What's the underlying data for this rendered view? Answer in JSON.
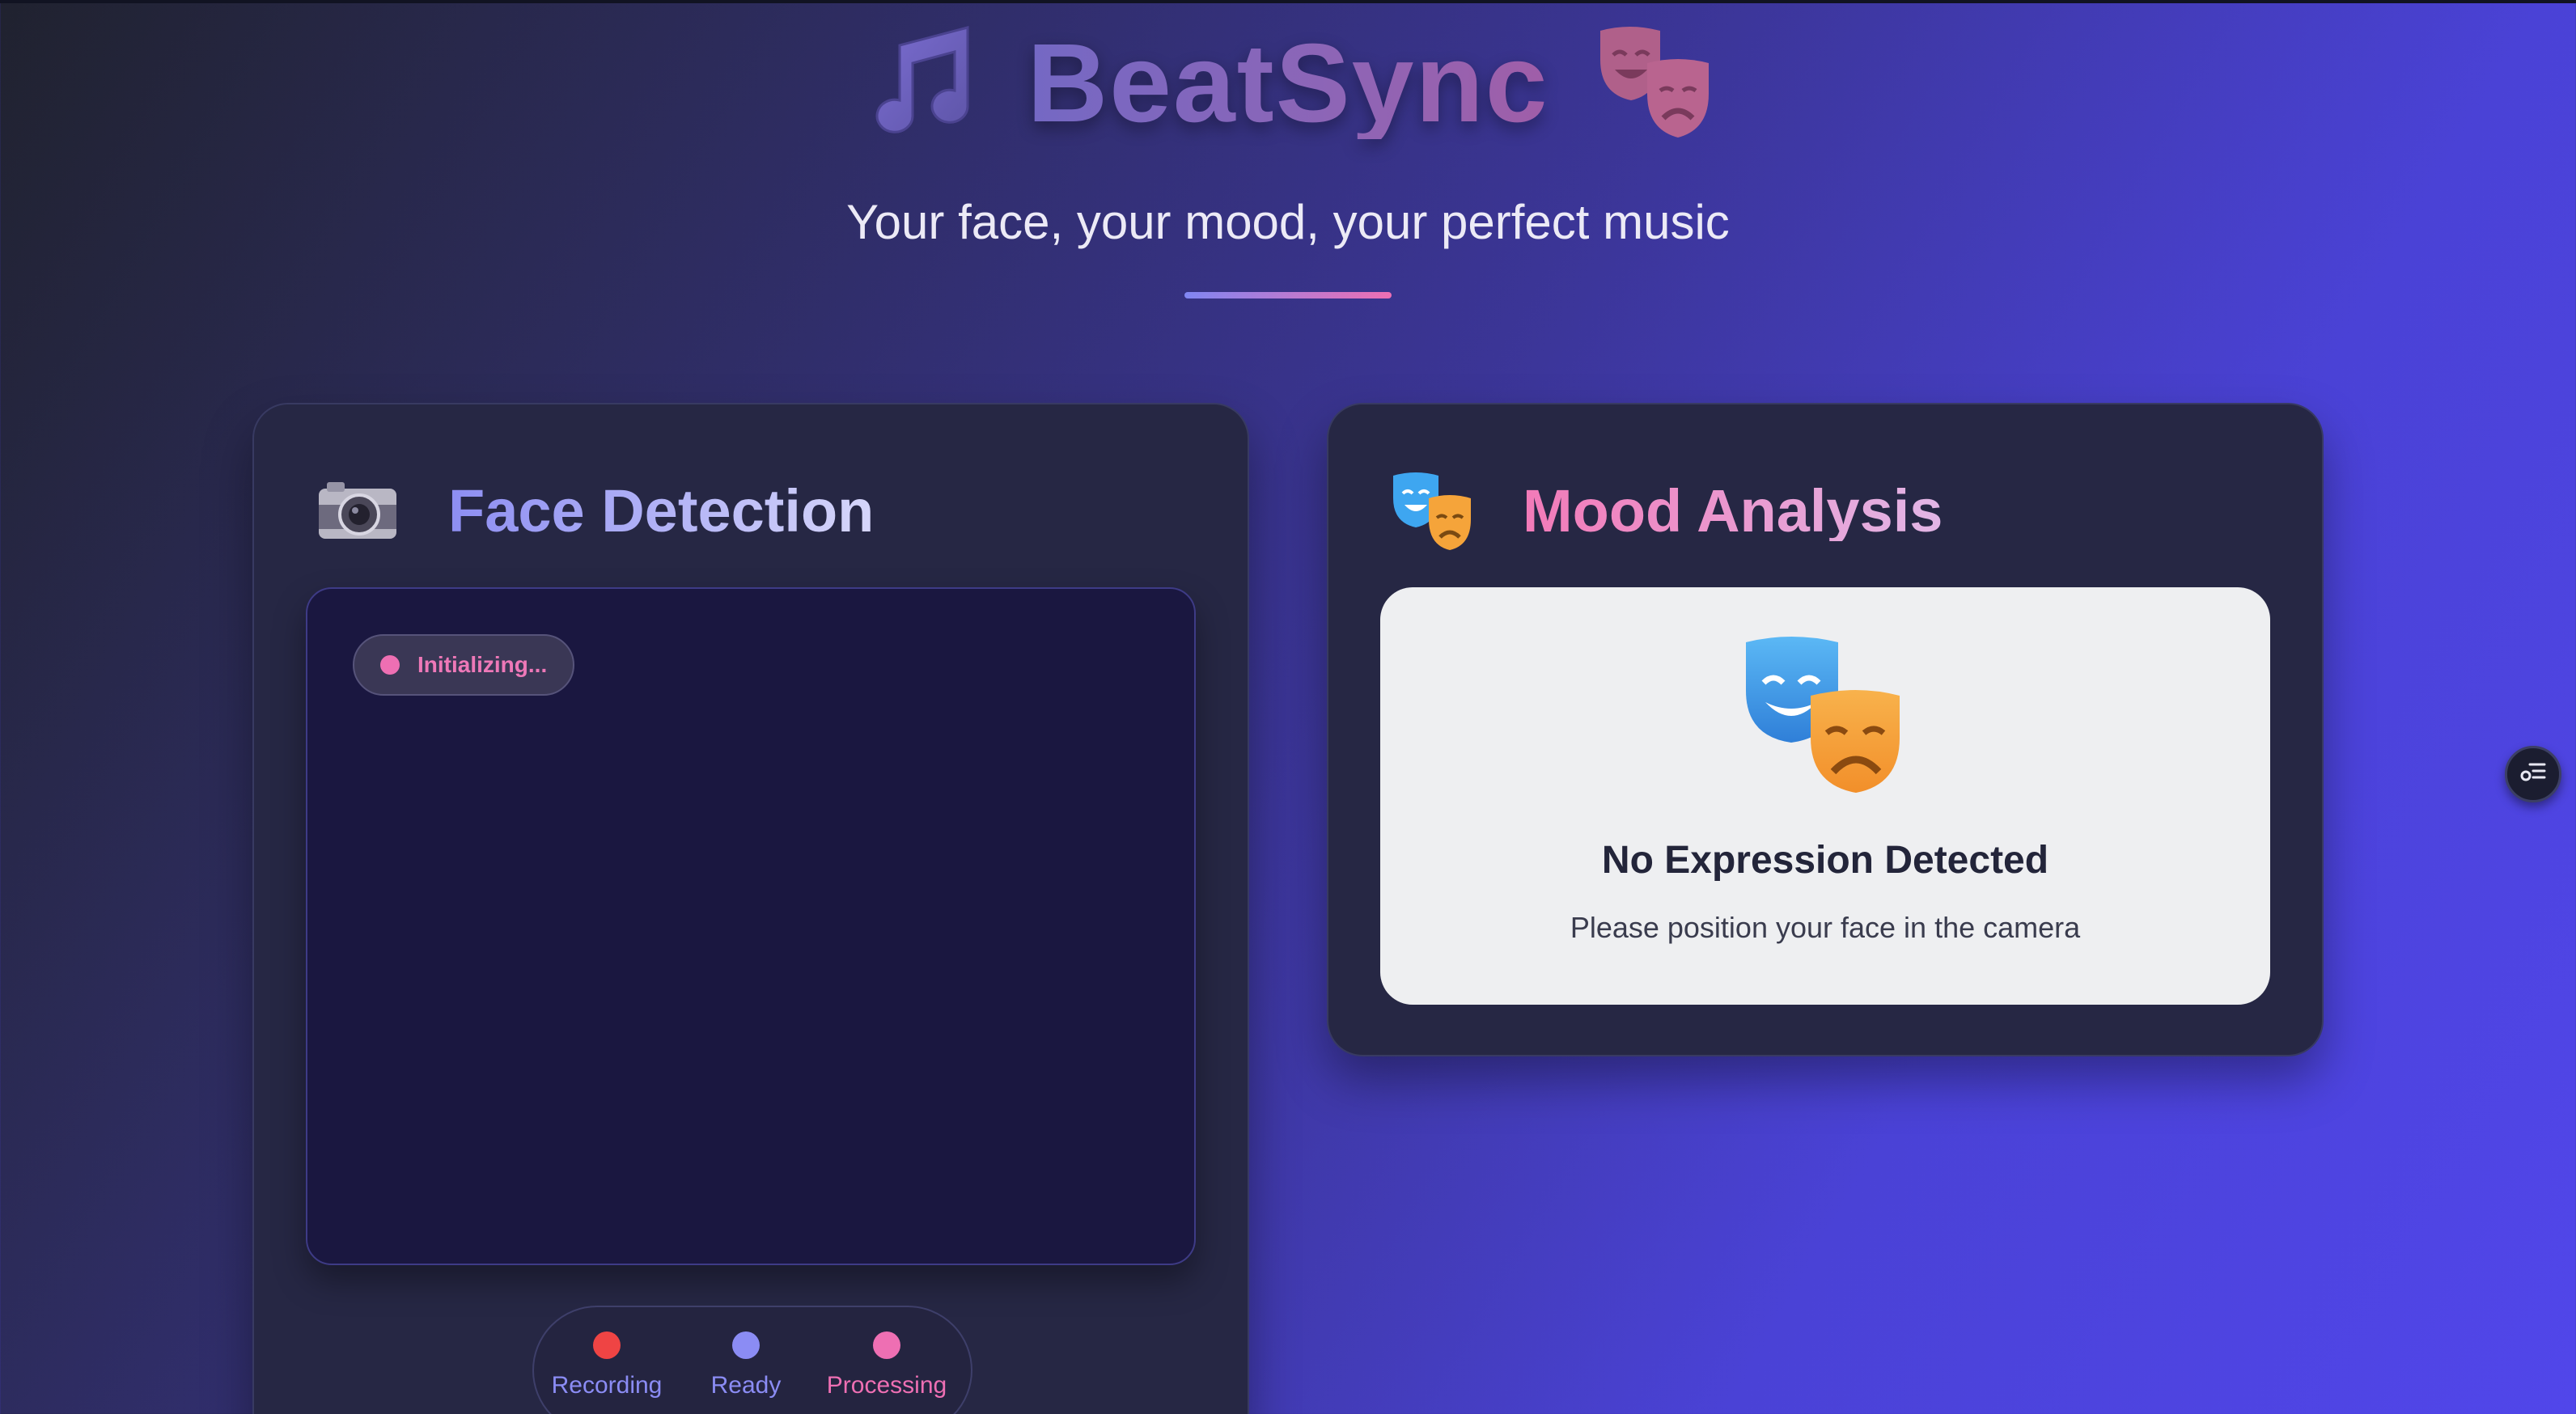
{
  "app": {
    "title": "BeatSync",
    "subtitle": "Your face, your mood, your perfect music"
  },
  "icons": {
    "title_left": "musical-note-icon",
    "title_right": "theater-masks-icon",
    "face_card": "camera-icon",
    "mood_card": "theater-masks-icon",
    "side_button": "list-settings-icon"
  },
  "face_detection": {
    "title": "Face Detection",
    "status_badge": "Initializing...",
    "legend": [
      {
        "label": "Recording",
        "color": "#ef4444"
      },
      {
        "label": "Ready",
        "color": "#8b8cf4"
      },
      {
        "label": "Processing",
        "color": "#ee6fb3"
      }
    ]
  },
  "mood_analysis": {
    "title": "Mood Analysis",
    "expression_title": "No Expression Detected",
    "expression_hint": "Please position your face in the camera"
  },
  "colors": {
    "accent_indigo": "#8086f2",
    "accent_pink": "#ee6fb3",
    "card_bg": "#262744",
    "recording_red": "#ef4444"
  }
}
